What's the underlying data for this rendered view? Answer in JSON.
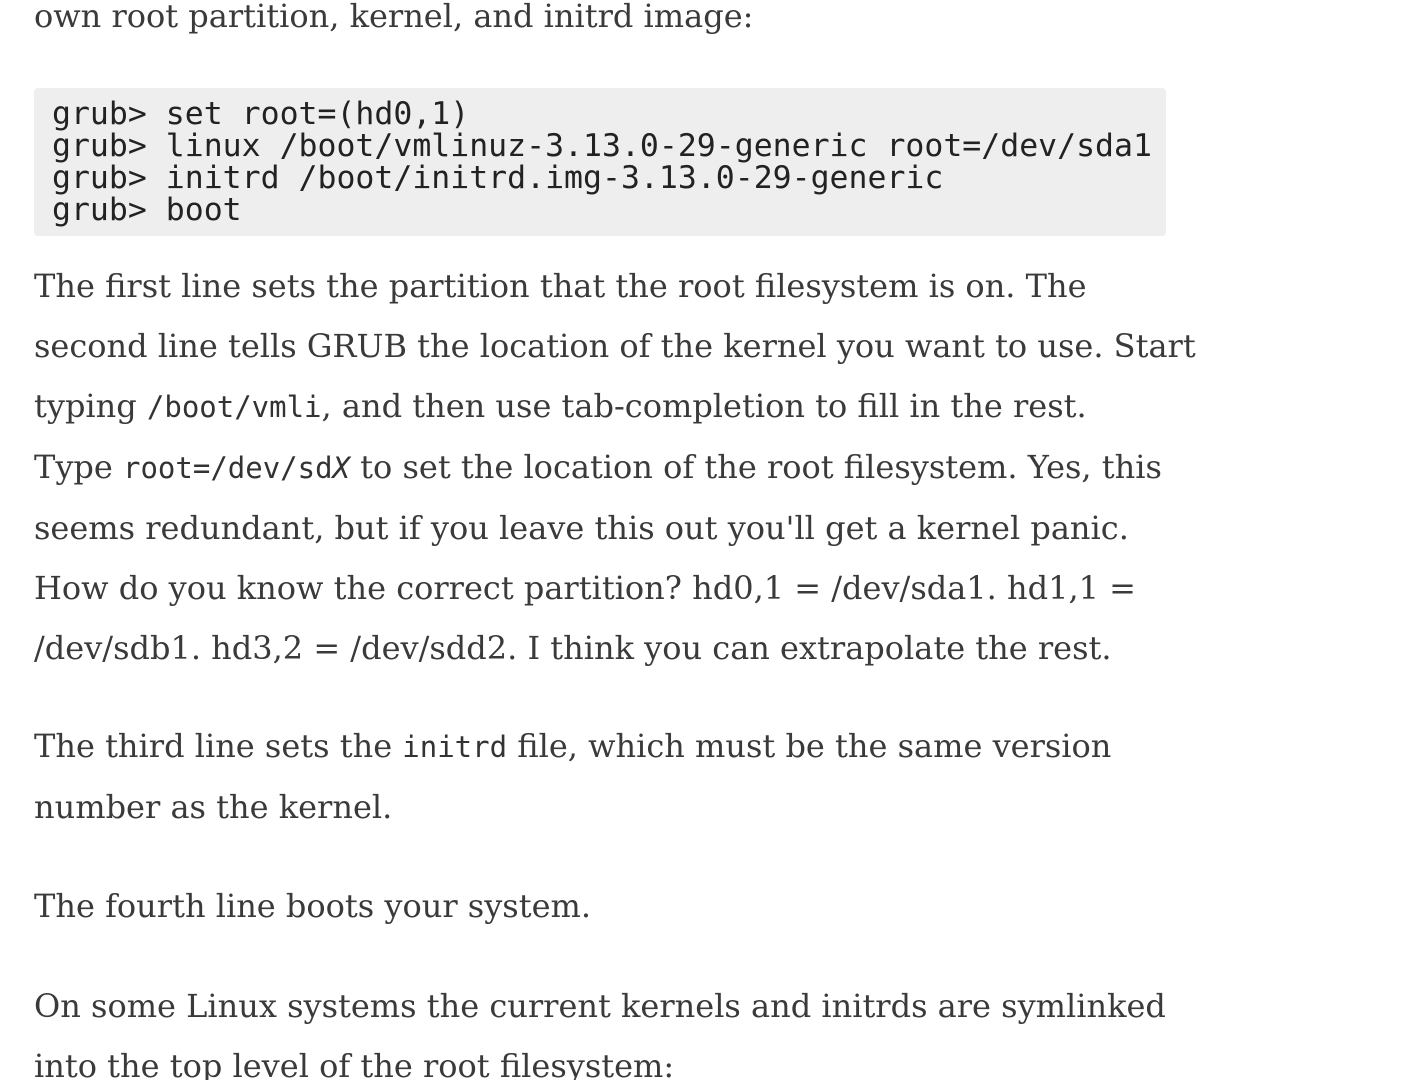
{
  "intro": {
    "tail": "own root partition, kernel, and initrd image:"
  },
  "code": {
    "lines": [
      "grub> set root=(hd0,1)",
      "grub> linux /boot/vmlinuz-3.13.0-29-generic root=/dev/sda1",
      "grub> initrd /boot/initrd.img-3.13.0-29-generic",
      "grub> boot"
    ]
  },
  "para1": {
    "line1": "The first line sets the partition that the root filesystem is on. The",
    "line2": "second line tells GRUB the location of the kernel you want to use. Start",
    "line3_pre": "typing ",
    "line3_code": "/boot/vmli",
    "line3_post": ", and then use tab-completion to fill in the rest.",
    "line4_pre": "Type ",
    "line4_code": "root=/dev/sd",
    "line4_code_var": "X",
    "line4_post": " to set the location of the root filesystem. Yes, this",
    "line5": "seems redundant, but if you leave this out you'll get a kernel panic.",
    "line6": "How do you know the correct partition? hd0,1 = /dev/sda1. hd1,1 =",
    "line7": "/dev/sdb1. hd3,2 = /dev/sdd2. I think you can extrapolate the rest."
  },
  "para2": {
    "line1_pre": "The third line sets the ",
    "line1_code": "initrd",
    "line1_post": " file, which must be the same version",
    "line2": "number as the kernel."
  },
  "para3": {
    "line1": "The fourth line boots your system."
  },
  "para4": {
    "line1": "On some Linux systems the current kernels and initrds are symlinked",
    "line2": "into the top level of the root filesystem:"
  }
}
